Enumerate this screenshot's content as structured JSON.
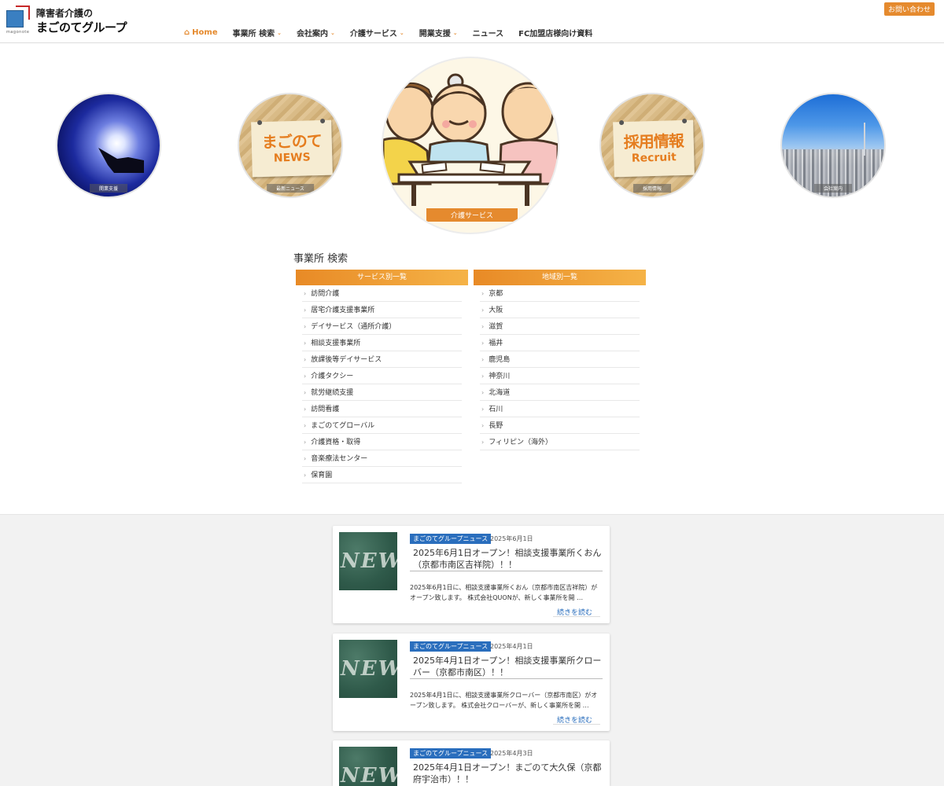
{
  "header": {
    "logo_line1": "障害者介護の",
    "logo_line2": "まごのてグループ",
    "logo_caption": "magonote",
    "contact_label": "お問い合わせ",
    "nav": [
      {
        "label": "Home"
      },
      {
        "label": "事業所 検索"
      },
      {
        "label": "会社案内"
      },
      {
        "label": "介護サービス"
      },
      {
        "label": "開業支援"
      },
      {
        "label": "ニュース"
      },
      {
        "label": "FC加盟店様向け資料"
      }
    ]
  },
  "circles": {
    "c1_caption": "開業支援",
    "c2_big": "まごのて",
    "c2_small": "NEWS",
    "c2_caption": "最新ニュース",
    "c3_caption": "介護サービス",
    "c4_big": "採用情報",
    "c4_small": "Recruit",
    "c4_caption": "採用情報",
    "c5_caption": "会社案内"
  },
  "search": {
    "title": "事業所 検索",
    "service_header": "サービス別一覧",
    "region_header": "地域別一覧",
    "services": [
      "訪問介護",
      "居宅介護支援事業所",
      "デイサービス（通所介護）",
      "相談支援事業所",
      "放課後等デイサービス",
      "介護タクシー",
      "就労継続支援",
      "訪問看護",
      "まごのてグローバル",
      "介護資格・取得",
      "音楽療法センター",
      "保育園"
    ],
    "regions": [
      "京都",
      "大阪",
      "滋賀",
      "福井",
      "鹿児島",
      "神奈川",
      "北海道",
      "石川",
      "長野",
      "フィリピン（海外）"
    ]
  },
  "news": [
    {
      "category": "まごのてグループニュース",
      "date": "2025年6月1日",
      "title": "2025年6月1日オープン！相談支援事業所くおん（京都市南区吉祥院）！！",
      "excerpt": "2025年6月1日に、相談支援事業所くおん（京都市南区吉祥院）がオープン致します。 株式会社QUONが、新しく事業所を開 …",
      "more": "続きを読む",
      "thumb": "NEWS"
    },
    {
      "category": "まごのてグループニュース",
      "date": "2025年4月1日",
      "title": "2025年4月1日オープン！相談支援事業所クローバー（京都市南区）！！",
      "excerpt": "2025年4月1日に、相談支援事業所クローバー（京都市南区）がオープン致します。 株式会社クローバーが、新しく事業所を開 …",
      "more": "続きを読む",
      "thumb": "NEWS"
    },
    {
      "category": "まごのてグループニュース",
      "date": "2025年4月3日",
      "title": "2025年4月1日オープン！まごのて大久保（京都府宇治市）！！",
      "excerpt": "",
      "more": "",
      "thumb": "NEWS"
    }
  ]
}
